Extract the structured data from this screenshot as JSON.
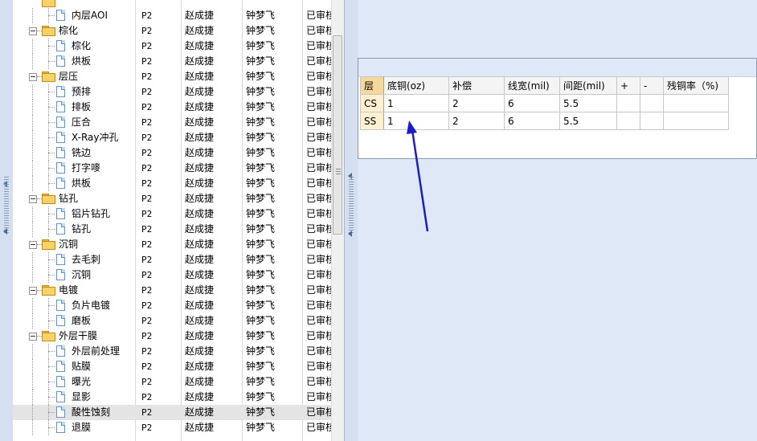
{
  "tree": {
    "rows": [
      {
        "level": 1,
        "kind": "item",
        "name": "内层AOI",
        "c1": "P2",
        "c2": "赵成捷",
        "c3": "钟梦飞",
        "c4": "已审核"
      },
      {
        "level": 0,
        "kind": "folder",
        "name": "棕化",
        "c1": "P2",
        "c2": "赵成捷",
        "c3": "钟梦飞",
        "c4": "已审核"
      },
      {
        "level": 1,
        "kind": "item",
        "name": "棕化",
        "c1": "P2",
        "c2": "赵成捷",
        "c3": "钟梦飞",
        "c4": "已审核"
      },
      {
        "level": 1,
        "kind": "item",
        "name": "烘板",
        "c1": "P2",
        "c2": "赵成捷",
        "c3": "钟梦飞",
        "c4": "已审核"
      },
      {
        "level": 0,
        "kind": "folder",
        "name": "层压",
        "c1": "P2",
        "c2": "赵成捷",
        "c3": "钟梦飞",
        "c4": "已审核"
      },
      {
        "level": 1,
        "kind": "item",
        "name": "预排",
        "c1": "P2",
        "c2": "赵成捷",
        "c3": "钟梦飞",
        "c4": "已审核"
      },
      {
        "level": 1,
        "kind": "item",
        "name": "排板",
        "c1": "P2",
        "c2": "赵成捷",
        "c3": "钟梦飞",
        "c4": "已审核"
      },
      {
        "level": 1,
        "kind": "item",
        "name": "压合",
        "c1": "P2",
        "c2": "赵成捷",
        "c3": "钟梦飞",
        "c4": "已审核"
      },
      {
        "level": 1,
        "kind": "item",
        "name": "X-Ray冲孔",
        "c1": "P2",
        "c2": "赵成捷",
        "c3": "钟梦飞",
        "c4": "已审核"
      },
      {
        "level": 1,
        "kind": "item",
        "name": "铣边",
        "c1": "P2",
        "c2": "赵成捷",
        "c3": "钟梦飞",
        "c4": "已审核"
      },
      {
        "level": 1,
        "kind": "item",
        "name": "打字嘜",
        "c1": "P2",
        "c2": "赵成捷",
        "c3": "钟梦飞",
        "c4": "已审核"
      },
      {
        "level": 1,
        "kind": "item",
        "name": "烘板",
        "c1": "P2",
        "c2": "赵成捷",
        "c3": "钟梦飞",
        "c4": "已审核"
      },
      {
        "level": 0,
        "kind": "folder",
        "name": "钻孔",
        "c1": "P2",
        "c2": "赵成捷",
        "c3": "钟梦飞",
        "c4": "已审核"
      },
      {
        "level": 1,
        "kind": "item",
        "name": "铝片钻孔",
        "c1": "P2",
        "c2": "赵成捷",
        "c3": "钟梦飞",
        "c4": "已审核"
      },
      {
        "level": 1,
        "kind": "item",
        "name": "钻孔",
        "c1": "P2",
        "c2": "赵成捷",
        "c3": "钟梦飞",
        "c4": "已审核"
      },
      {
        "level": 0,
        "kind": "folder",
        "name": "沉铜",
        "c1": "P2",
        "c2": "赵成捷",
        "c3": "钟梦飞",
        "c4": "已审核"
      },
      {
        "level": 1,
        "kind": "item",
        "name": "去毛刺",
        "c1": "P2",
        "c2": "赵成捷",
        "c3": "钟梦飞",
        "c4": "已审核"
      },
      {
        "level": 1,
        "kind": "item",
        "name": "沉铜",
        "c1": "P2",
        "c2": "赵成捷",
        "c3": "钟梦飞",
        "c4": "已审核"
      },
      {
        "level": 0,
        "kind": "folder",
        "name": "电镀",
        "c1": "P2",
        "c2": "赵成捷",
        "c3": "钟梦飞",
        "c4": "已审核"
      },
      {
        "level": 1,
        "kind": "item",
        "name": "负片电镀",
        "c1": "P2",
        "c2": "赵成捷",
        "c3": "钟梦飞",
        "c4": "已审核"
      },
      {
        "level": 1,
        "kind": "item",
        "name": "磨板",
        "c1": "P2",
        "c2": "赵成捷",
        "c3": "钟梦飞",
        "c4": "已审核"
      },
      {
        "level": 0,
        "kind": "folder",
        "name": "外层干膜",
        "c1": "P2",
        "c2": "赵成捷",
        "c3": "钟梦飞",
        "c4": "已审核"
      },
      {
        "level": 1,
        "kind": "item",
        "name": "外层前处理",
        "c1": "P2",
        "c2": "赵成捷",
        "c3": "钟梦飞",
        "c4": "已审核"
      },
      {
        "level": 1,
        "kind": "item",
        "name": "贴膜",
        "c1": "P2",
        "c2": "赵成捷",
        "c3": "钟梦飞",
        "c4": "已审核"
      },
      {
        "level": 1,
        "kind": "item",
        "name": "曝光",
        "c1": "P2",
        "c2": "赵成捷",
        "c3": "钟梦飞",
        "c4": "已审核"
      },
      {
        "level": 1,
        "kind": "item",
        "name": "显影",
        "c1": "P2",
        "c2": "赵成捷",
        "c3": "钟梦飞",
        "c4": "已审核"
      },
      {
        "level": 1,
        "kind": "item",
        "name": "酸性蚀刻",
        "c1": "P2",
        "c2": "赵成捷",
        "c3": "钟梦飞",
        "c4": "已审核",
        "selected": true
      },
      {
        "level": 1,
        "kind": "item",
        "name": "退膜",
        "c1": "P2",
        "c2": "赵成捷",
        "c3": "钟梦飞",
        "c4": "已审核"
      }
    ]
  },
  "grid": {
    "headers": [
      "层",
      "底铜(oz)",
      "补偿",
      "线宽(mil)",
      "间距(mil)",
      "+",
      "-",
      "残铜率（%)"
    ],
    "rows": [
      [
        "CS",
        "1",
        "2",
        "6",
        "5.5",
        "",
        "",
        ""
      ],
      [
        "SS",
        "1",
        "2",
        "6",
        "5.5",
        "",
        "",
        ""
      ]
    ]
  },
  "colors": {
    "annotation_arrow": "#1a1acf",
    "selected_row": "#e4e4e4",
    "folder": "#f6d269"
  }
}
